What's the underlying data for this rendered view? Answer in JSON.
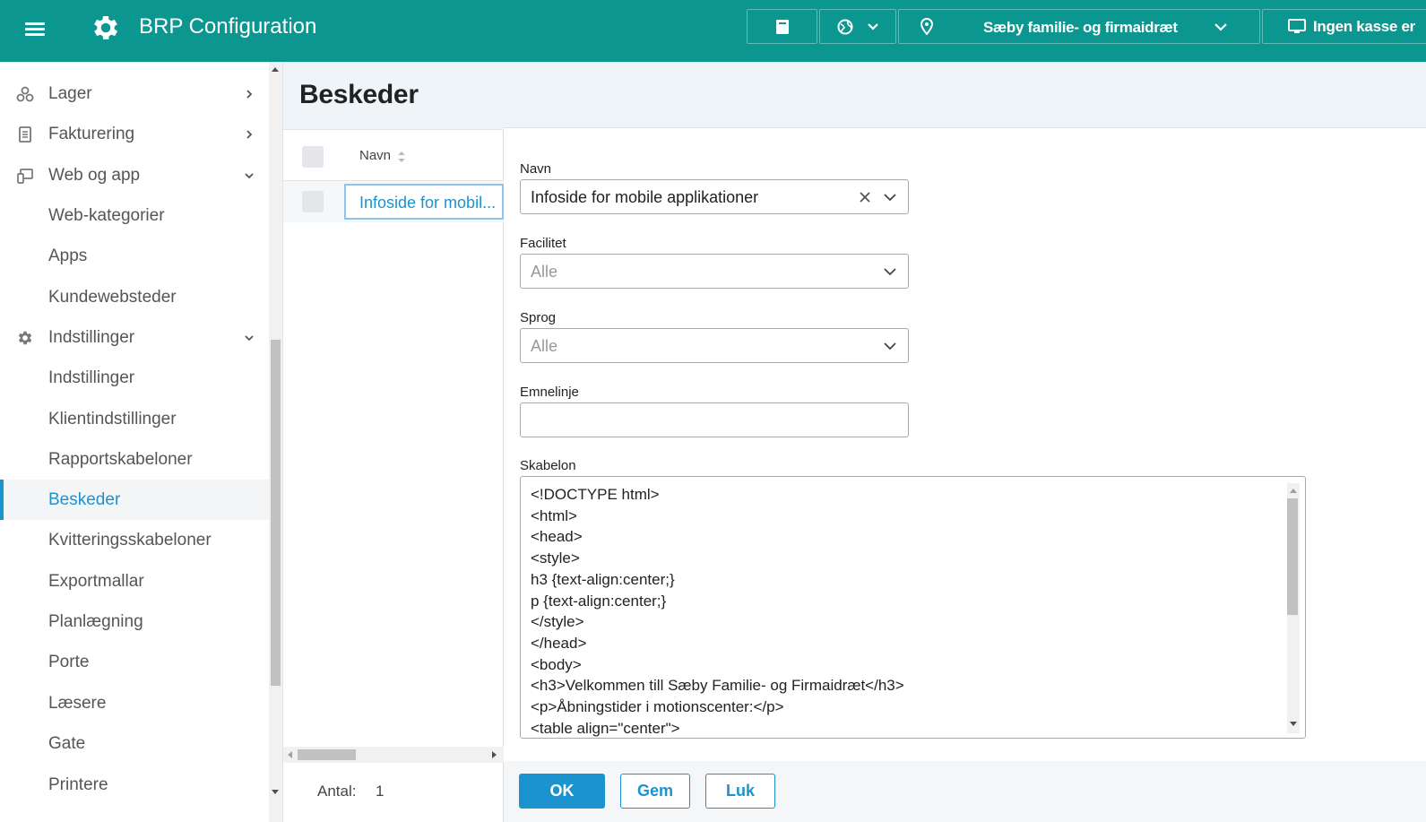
{
  "header": {
    "app_title": "BRP Configuration",
    "facility": "Sæby familie- og firmaidræt",
    "register": "Ingen kasse er"
  },
  "sidebar": {
    "items": [
      {
        "label": "Lager",
        "icon": "bikes-icon",
        "expandable": "chevron-right"
      },
      {
        "label": "Fakturering",
        "icon": "invoice-icon",
        "expandable": "chevron-right"
      },
      {
        "label": "Web og app",
        "icon": "web-app-icon",
        "expandable": "chevron-down"
      },
      {
        "label": "Web-kategorier"
      },
      {
        "label": "Apps"
      },
      {
        "label": "Kundewebsteder"
      },
      {
        "label": "Indstillinger",
        "icon": "gear-icon",
        "expandable": "chevron-down"
      },
      {
        "label": "Indstillinger"
      },
      {
        "label": "Klientindstillinger"
      },
      {
        "label": "Rapportskabeloner"
      },
      {
        "label": "Beskeder",
        "active": true
      },
      {
        "label": "Kvitteringsskabeloner"
      },
      {
        "label": "Exportmallar"
      },
      {
        "label": "Planlægning"
      },
      {
        "label": "Porte"
      },
      {
        "label": "Læsere"
      },
      {
        "label": "Gate"
      },
      {
        "label": "Printere"
      }
    ]
  },
  "list": {
    "title": "Beskeder",
    "column_name": "Navn",
    "rows": [
      {
        "name": "Infoside for mobil..."
      }
    ],
    "count_label": "Antal:",
    "count_value": "1"
  },
  "form": {
    "name_label": "Navn",
    "name_value": "Infoside for mobile applikationer",
    "facility_label": "Facilitet",
    "facility_placeholder": "Alle",
    "language_label": "Sprog",
    "language_placeholder": "Alle",
    "subject_label": "Emnelinje",
    "subject_value": "",
    "template_label": "Skabelon",
    "template_lines": [
      "<!DOCTYPE html>",
      "<html>",
      "<head>",
      "<style>",
      "h3 {text-align:center;}",
      "p {text-align:center;}",
      "</style>",
      "</head>",
      "<body>",
      "<h3>Velkommen till Sæby Familie- og Firmaidræt</h3>",
      "<p>Åbningstider i motionscenter:</p>",
      "<table align=\"center\">"
    ]
  },
  "buttons": {
    "ok": "OK",
    "save": "Gem",
    "close": "Luk"
  },
  "colors": {
    "topbar": "#0b9690",
    "accent": "#1a93cf"
  }
}
